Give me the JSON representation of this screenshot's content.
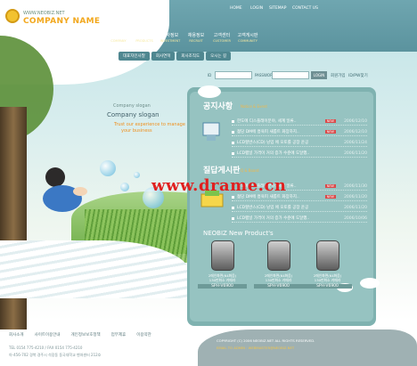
{
  "logo": {
    "url": "WWW.NEOBIZ.NET",
    "name": "COMPANY NAME"
  },
  "top_nav": [
    "HOME",
    "LOGIN",
    "SITEMAP",
    "CONTACT US"
  ],
  "main_menu": [
    {
      "ko": "회사소개",
      "en": "COMPANY"
    },
    {
      "ko": "제품소개",
      "en": "PRODUCTS"
    },
    {
      "ko": "투자정보",
      "en": "INVESTMENT"
    },
    {
      "ko": "채용정보",
      "en": "RECRUIT"
    },
    {
      "ko": "고객센터",
      "en": "CUSTOMER"
    },
    {
      "ko": "고객게시판",
      "en": "COMMUNITY"
    }
  ],
  "sub_menu": [
    "대표자인사말",
    "회사연혁",
    "회사조직도",
    "오시는 길"
  ],
  "login": {
    "id_label": "ID",
    "pw_label": "PASSWORD",
    "button": "LOGIN",
    "join": "회원가입",
    "find": "ID/PW찾기"
  },
  "company": {
    "small": "Company slogan",
    "big": "Company slogan",
    "tag1": "Trust our experience to manage",
    "tag2": "your business"
  },
  "notice": {
    "title": "공지사항",
    "sub": "Notice & Event",
    "rows": [
      {
        "text": "한도에 디스플레이분야, 세계 일류..",
        "new": "NEW",
        "date": "2006/12/10"
      },
      {
        "text": "젊당 DM에 흥육피 새롭트 화장하지..",
        "new": "NEW",
        "date": "2006/12/10"
      },
      {
        "text": "LCD할반스(CD) 낭입 에 오토를 공장 운공",
        "new": "",
        "date": "2006/11/24"
      },
      {
        "text": "LCD팹널 가격이 거의 증가 수준에 도달했..",
        "new": "",
        "date": "2006/11/20"
      }
    ]
  },
  "qna": {
    "title": "질답게시판",
    "sub": "Q & Board",
    "rows": [
      {
        "text": "한도에 디스플레이분야, 세계 일류..",
        "new": "NEW",
        "date": "2006/11/30"
      },
      {
        "text": "젊당 DM에 흥육피 새롭트 화장하지..",
        "new": "NEW",
        "date": "2006/11/20"
      },
      {
        "text": "LCD할반스(CD) 낭입 에 오토를 공장 운공",
        "new": "",
        "date": "2006/11/20"
      },
      {
        "text": "LCD팹널 가격이 거의 증가 수준에 도달했..",
        "new": "",
        "date": "2006/10/06"
      }
    ]
  },
  "products": {
    "title": "NEOBIZ New Product's",
    "items": [
      {
        "name": "2메인화면(64화음)\n130만화소 카메라",
        "model": "SPH-V6900"
      },
      {
        "name": "2메인화면(64화음)\n130만화소 카메라",
        "model": "SPH-V6900"
      },
      {
        "name": "2메인화면(64화음)\n130만화소 카메라",
        "model": "SPH-V6900"
      }
    ]
  },
  "footer": {
    "links": [
      "회사소개",
      "사이트이용안내",
      "개인정보보호정책",
      "업무제휴",
      "이용약관"
    ],
    "line1": "TEL 0154 775-4210 / FAX 0154 775-4210",
    "line2": "아-456-702  경북 경주시 석장동 동국대학교 벤처센터 212호",
    "copy": "COPYRIGHT (C) 2006 NEOBIZ.NET ALL RIGHTS RESERVED.",
    "mail": "EMAIL TO ADMIN : WEBMASTER@NEOBIZ.NET"
  },
  "watermark": "www.drame.cn",
  "colors": {
    "header": "#5b939e",
    "accent": "#f2a81e",
    "panel": "#7fb2b0",
    "new_badge": "#d94a4a"
  }
}
